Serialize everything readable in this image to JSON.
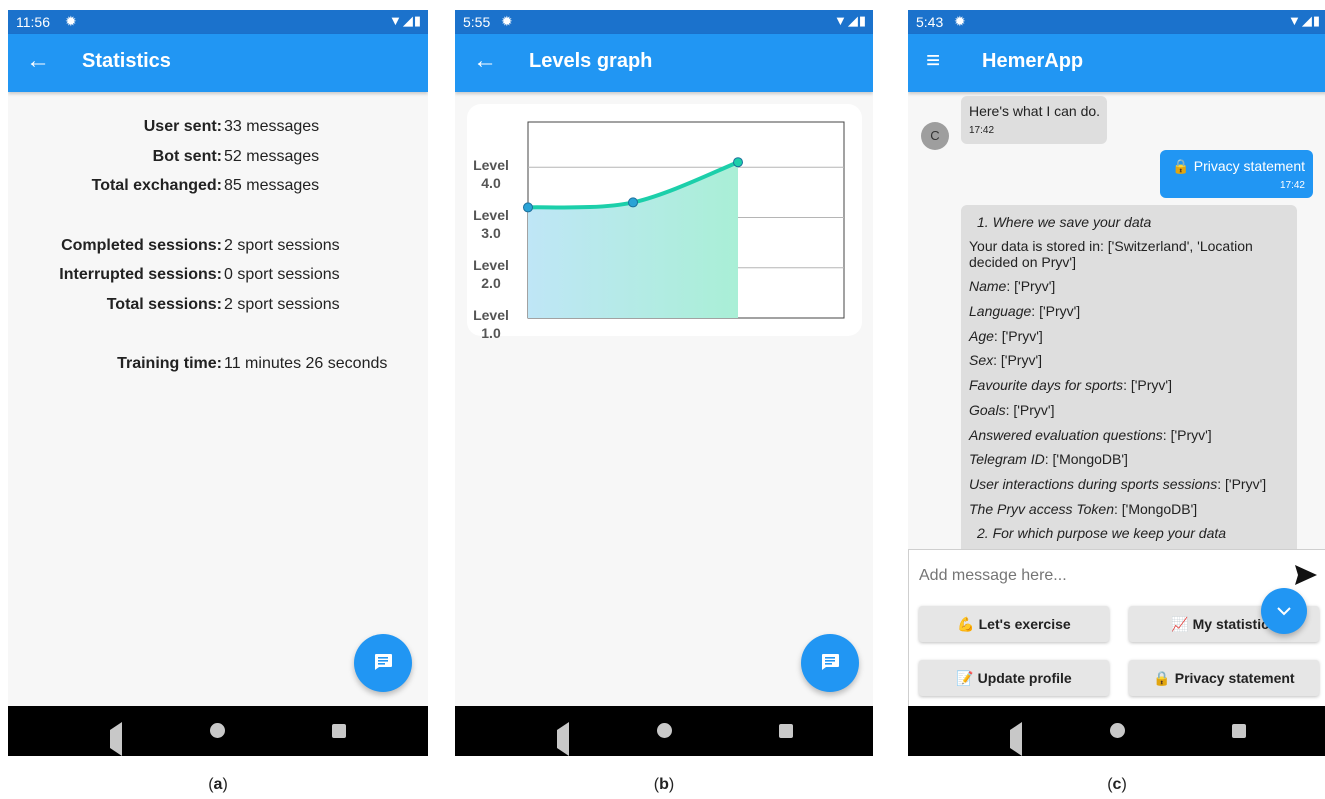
{
  "status_bars": [
    {
      "time": "11:56",
      "settings_icon": "gear-icon"
    },
    {
      "time": "5:55",
      "settings_icon": "gear-icon"
    },
    {
      "time": "5:43",
      "settings_icon": "gear-icon"
    }
  ],
  "panel_a": {
    "title": "Statistics",
    "nav_icon": "arrow-back-icon",
    "rows": [
      {
        "label": "User sent:",
        "value": "33 messages"
      },
      {
        "label": "Bot sent:",
        "value": "52 messages"
      },
      {
        "label": "Total exchanged:",
        "value": "85 messages"
      },
      {
        "label": "Completed sessions:",
        "value": "2 sport sessions"
      },
      {
        "label": "Interrupted sessions:",
        "value": "0 sport sessions"
      },
      {
        "label": "Total sessions:",
        "value": "2 sport sessions"
      },
      {
        "label": "Training time:",
        "value": "11 minutes 26 seconds"
      }
    ]
  },
  "panel_b": {
    "title": "Levels graph",
    "nav_icon": "arrow-back-icon",
    "chart_data": {
      "type": "area",
      "title": "",
      "xlabel": "",
      "ylabel": "",
      "y_tick_labels": [
        {
          "line1": "Level",
          "line2": "4.0"
        },
        {
          "line1": "Level",
          "line2": "3.0"
        },
        {
          "line1": "Level",
          "line2": "2.0"
        },
        {
          "line1": "Level",
          "line2": "1.0"
        }
      ],
      "ylim": [
        1.0,
        4.9
      ],
      "x": [
        0,
        1,
        2
      ],
      "values": [
        3.2,
        3.3,
        4.1
      ],
      "grid": "horizontal",
      "line_color": "#1ccfaa",
      "point_color": "#2aa3d6",
      "fill_from": "#bfe6f6",
      "fill_to": "#a9efd6"
    }
  },
  "panel_c": {
    "title": "HemerApp",
    "nav_icon": "menu-icon",
    "avatar_letter": "C",
    "messages": [
      {
        "text": "Here's what I can do.",
        "time": "17:42"
      },
      {
        "text": "🔒 Privacy statement",
        "time": "17:42"
      }
    ],
    "privacy": {
      "heading1": "1. Where we save your data",
      "stored_in": "Your data is stored in: ['Switzerland', 'Location",
      "stored_in_2": "decided on Pryv']",
      "items": [
        {
          "key": "Name",
          "value": ": ['Pryv']"
        },
        {
          "key": "Language",
          "value": ": ['Pryv']"
        },
        {
          "key": "Age",
          "value": ": ['Pryv']"
        },
        {
          "key": "Sex",
          "value": ": ['Pryv']"
        },
        {
          "key": "Favourite days for sports",
          "value": ": ['Pryv']"
        },
        {
          "key": "Goals",
          "value": ": ['Pryv']"
        },
        {
          "key": "Answered evaluation questions",
          "value": ": ['Pryv']"
        },
        {
          "key": "Telegram ID",
          "value": ": ['MongoDB']"
        },
        {
          "key": "User interactions during sports sessions",
          "value": ": ['Pryv']"
        },
        {
          "key": "The Pryv access Token",
          "value": ": ['MongoDB']"
        }
      ],
      "heading2": "2. For which purpose we keep your data"
    },
    "input_placeholder": "Add message here...",
    "quick_replies": [
      "💪 Let's exercise",
      "📈 My statistics",
      "📝 Update profile",
      "🔒 Privacy statement"
    ]
  },
  "captions": [
    "a",
    "b",
    "c"
  ]
}
